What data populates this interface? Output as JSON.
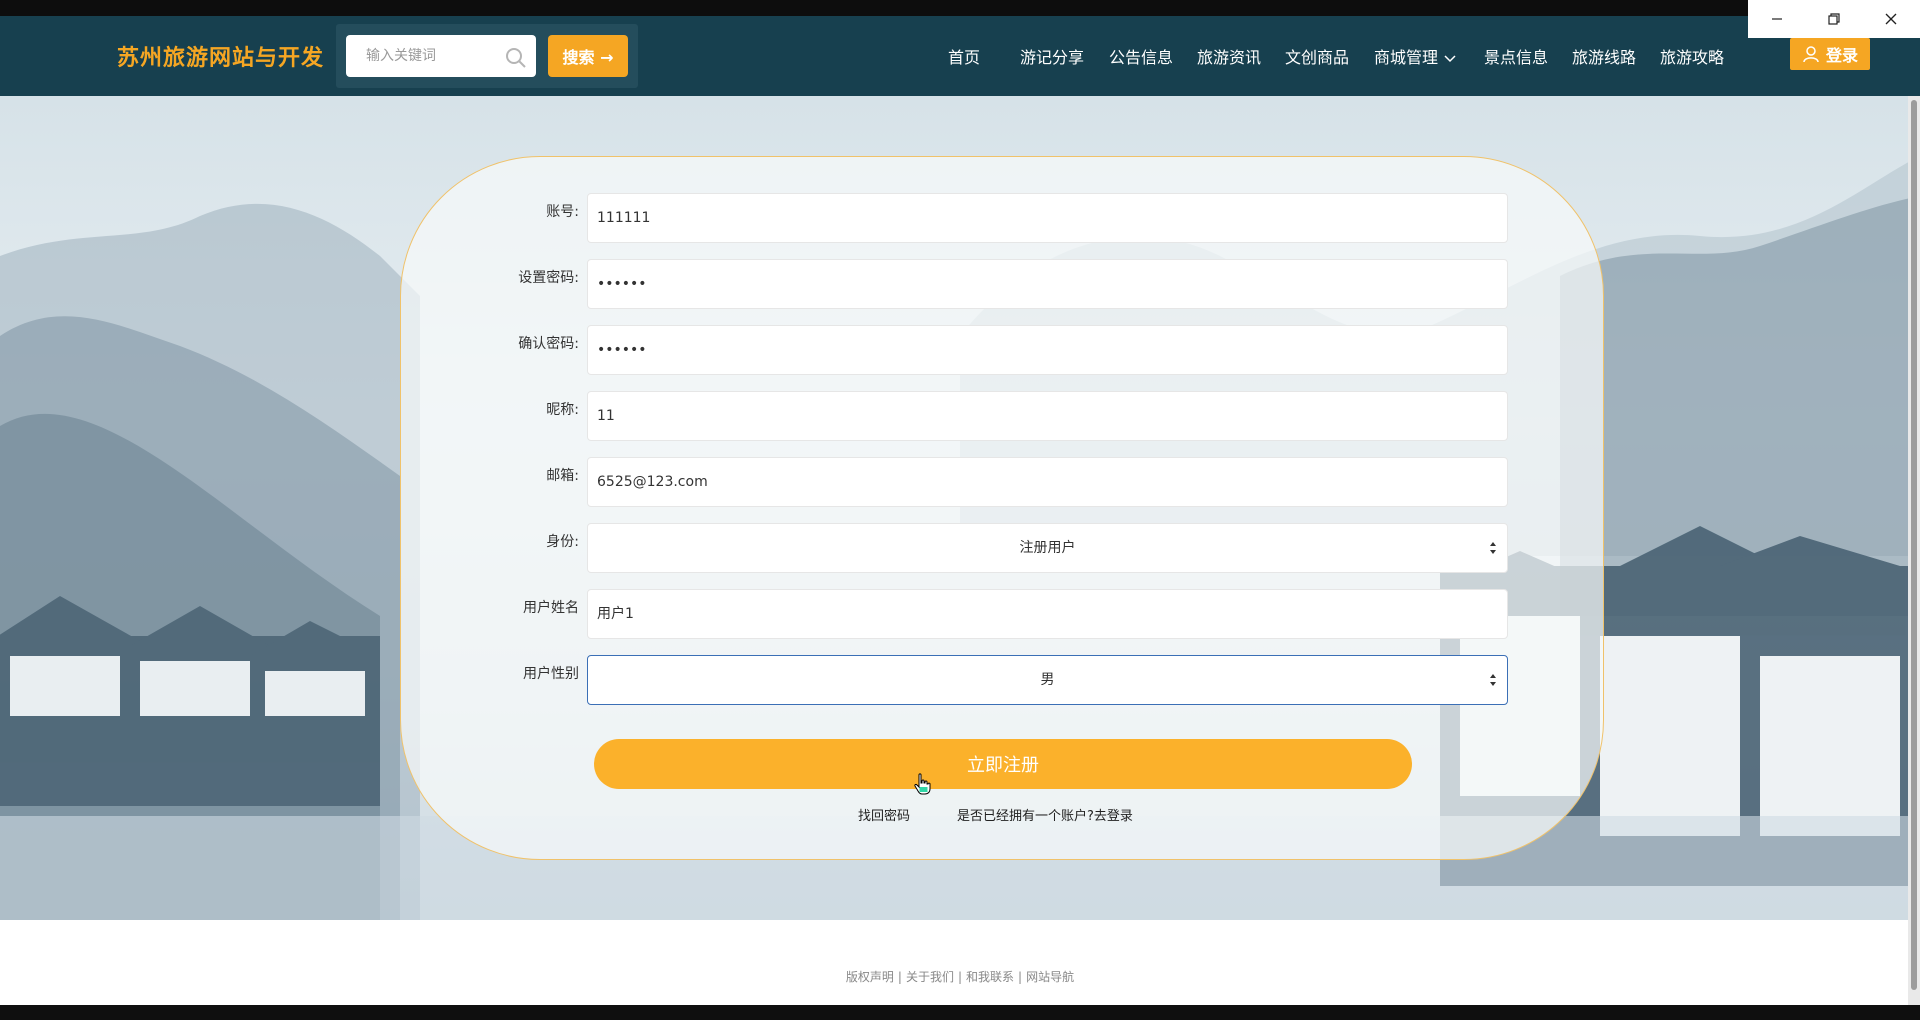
{
  "window_controls": {
    "minimize_icon": "minimize-icon",
    "restore_icon": "restore-icon",
    "close_icon": "close-icon"
  },
  "header": {
    "brand": "苏州旅游网站与开发",
    "search": {
      "placeholder": "输入关键词",
      "button_label": "搜索 →"
    },
    "nav": [
      {
        "label": "首页"
      },
      {
        "label": "游记分享"
      },
      {
        "label": "公告信息"
      },
      {
        "label": "旅游资讯"
      },
      {
        "label": "文创商品"
      },
      {
        "label": "商城管理"
      },
      {
        "label": "景点信息"
      },
      {
        "label": "旅游线路"
      },
      {
        "label": "旅游攻略"
      }
    ],
    "login_label": "登录"
  },
  "form": {
    "fields": [
      {
        "label": "账号:",
        "value": "111111"
      },
      {
        "label": "设置密码:",
        "value": "••••••"
      },
      {
        "label": "确认密码:",
        "value": "••••••"
      },
      {
        "label": "昵称:",
        "value": "11"
      },
      {
        "label": "邮箱:",
        "value": "6525@123.com"
      },
      {
        "label": "身份:",
        "value": "注册用户"
      },
      {
        "label": "用户姓名",
        "value": "用户1"
      },
      {
        "label": "用户性别",
        "value": "男"
      }
    ],
    "submit_label": "立即注册",
    "forgot_label": "找回密码",
    "login_link_label": "是否已经拥有一个账户?去登录"
  },
  "footer": {
    "links": [
      "版权声明",
      "关于我们",
      "和我联系",
      "网站导航"
    ],
    "separator": "|"
  },
  "colors": {
    "navbar": "#17404f",
    "accent": "#f5a623",
    "submit": "#fbb12b",
    "focus_border": "#3b6fb6"
  }
}
